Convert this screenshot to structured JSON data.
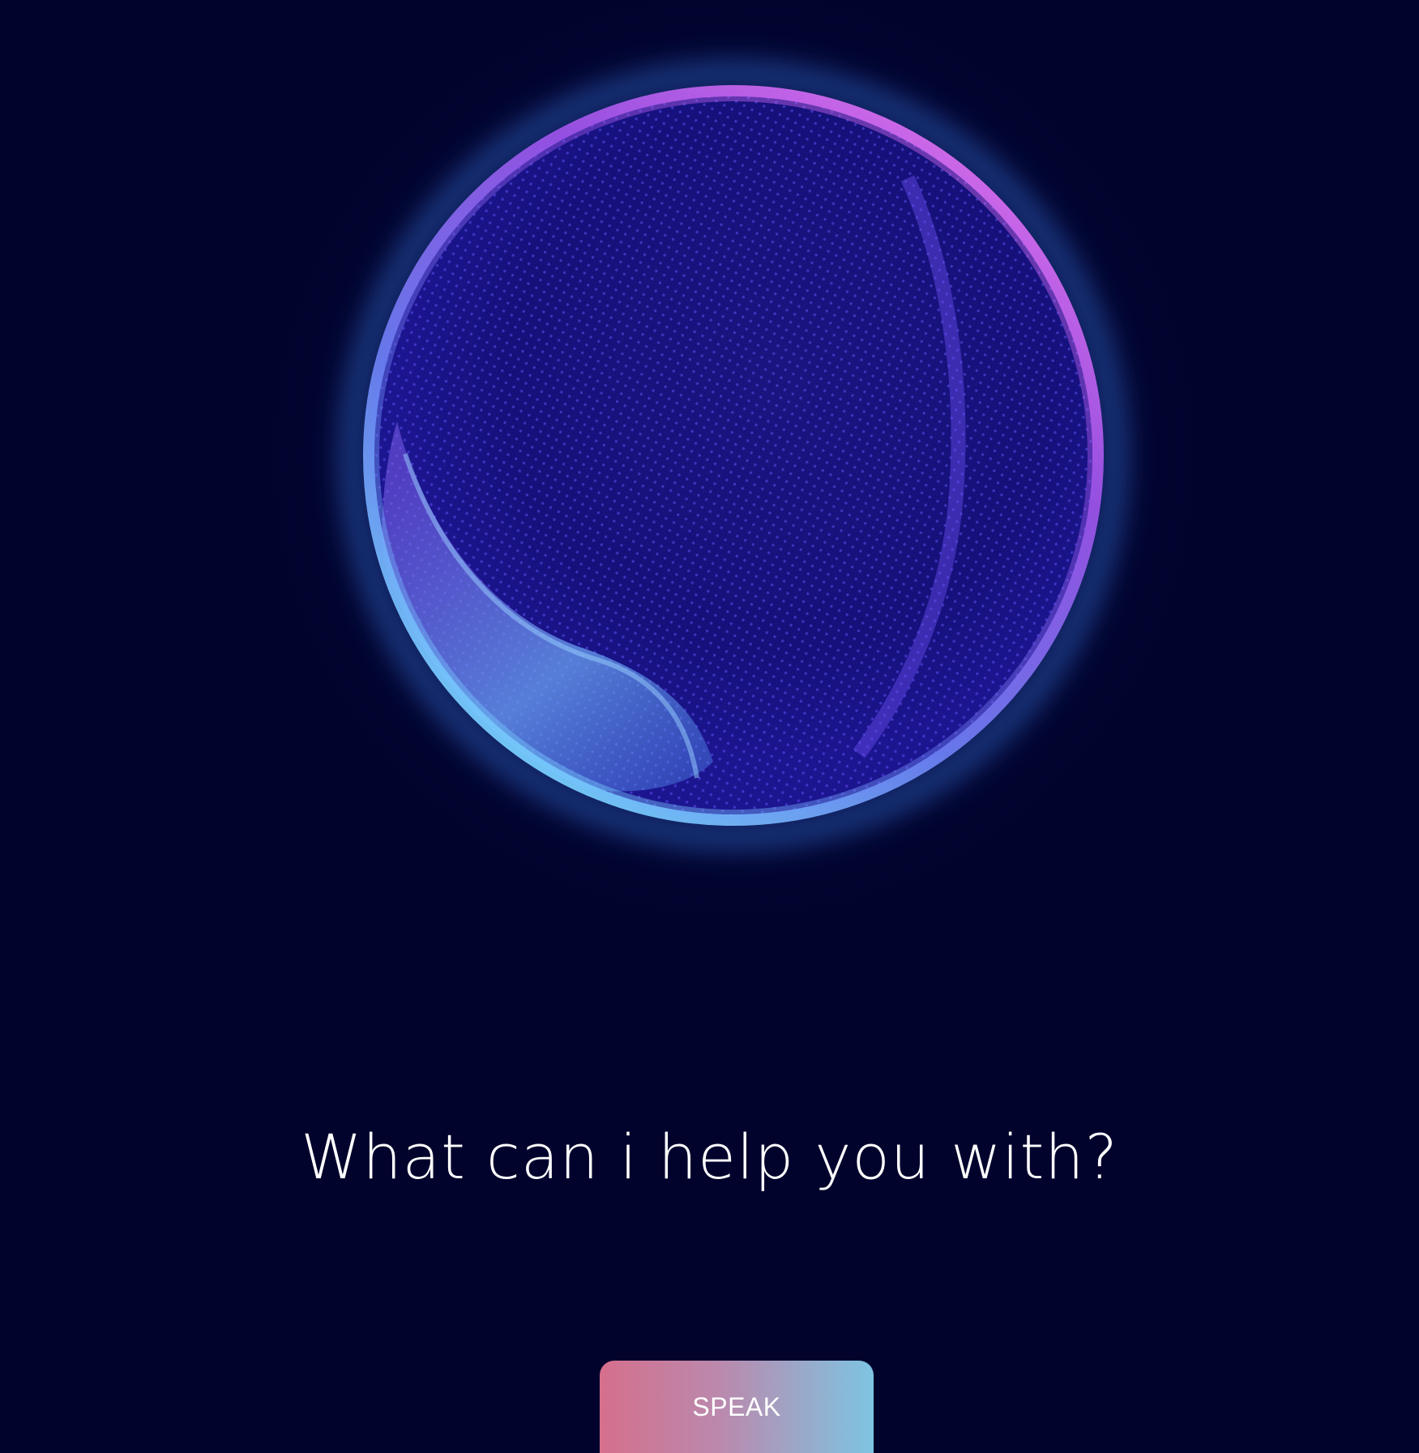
{
  "assistant": {
    "orb_icon": "particle-sphere-icon",
    "prompt": "What can i help you with?"
  },
  "actions": {
    "speak_label": "SPEAK"
  },
  "colors": {
    "background": "#01032c",
    "orb_magenta": "#c04ee8",
    "orb_indigo": "#2a1a9a",
    "orb_cyan": "#6ad0f0",
    "button_left": "#d66f8c",
    "button_right": "#7ec4e2"
  }
}
